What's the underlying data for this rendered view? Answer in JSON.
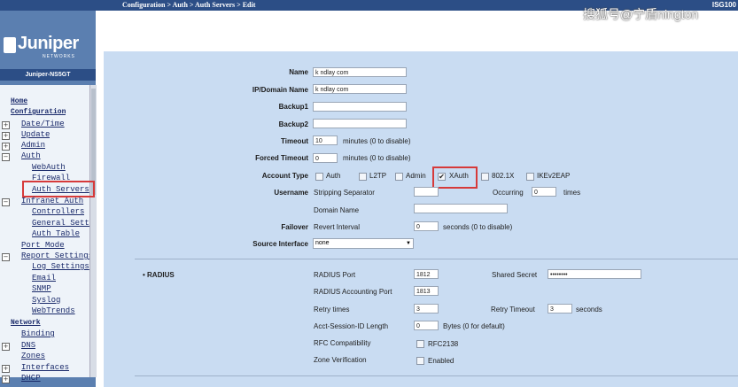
{
  "topbar": {
    "breadcrumb": "Configuration > Auth > Auth Servers > Edit",
    "device_model": "ISG100",
    "watermark": "搜狐号@宁盾nington"
  },
  "sidebar": {
    "logo": "Juniper",
    "logo_sub": "NETWORKS",
    "device_name": "Juniper-NS5GT",
    "items": [
      {
        "label": "Home",
        "level": 0
      },
      {
        "label": "Configuration",
        "level": 0
      },
      {
        "label": "Date/Time",
        "level": 1
      },
      {
        "label": "Update",
        "level": 1
      },
      {
        "label": "Admin",
        "level": 1
      },
      {
        "label": "Auth",
        "level": 1
      },
      {
        "label": "WebAuth",
        "level": 2
      },
      {
        "label": "Firewall",
        "level": 2
      },
      {
        "label": "Auth Servers",
        "level": 2
      },
      {
        "label": "Infranet Auth",
        "level": 1
      },
      {
        "label": "Controllers",
        "level": 2
      },
      {
        "label": "General Settings",
        "level": 2
      },
      {
        "label": "Auth Table",
        "level": 2
      },
      {
        "label": "Port Mode",
        "level": 1
      },
      {
        "label": "Report Settings",
        "level": 1
      },
      {
        "label": "Log Settings",
        "level": 2
      },
      {
        "label": "Email",
        "level": 2
      },
      {
        "label": "SNMP",
        "level": 2
      },
      {
        "label": "Syslog",
        "level": 2
      },
      {
        "label": "WebTrends",
        "level": 2
      },
      {
        "label": "Network",
        "level": 0
      },
      {
        "label": "Binding",
        "level": 1
      },
      {
        "label": "DNS",
        "level": 1
      },
      {
        "label": "Zones",
        "level": 1
      },
      {
        "label": "Interfaces",
        "level": 1
      },
      {
        "label": "DHCP",
        "level": 1
      }
    ]
  },
  "form": {
    "name_label": "Name",
    "name_value": "k ndlay com",
    "ip_label": "IP/Domain Name",
    "ip_value": "k ndlay com",
    "backup1_label": "Backup1",
    "backup2_label": "Backup2",
    "timeout_label": "Timeout",
    "timeout_value": "10",
    "timeout_suffix": "minutes (0 to disable)",
    "forced_timeout_label": "Forced Timeout",
    "forced_timeout_value": "0",
    "forced_timeout_suffix": "minutes (0 to disable)",
    "account_type_label": "Account Type",
    "account_types": [
      "Auth",
      "L2TP",
      "Admin",
      "XAuth",
      "802.1X",
      "IKEv2EAP"
    ],
    "account_type_checked": "XAuth",
    "username_label": "Username",
    "stripping_separator": "Stripping Separator",
    "occurring_label": "Occurring",
    "occurring_value": "0",
    "occurring_suffix": "times",
    "domain_name_label": "Domain Name",
    "failover_label": "Failover",
    "revert_interval_label": "Revert Interval",
    "revert_interval_value": "0",
    "revert_interval_suffix": "seconds (0 to disable)",
    "source_interface_label": "Source Interface",
    "source_interface_value": "none"
  },
  "radius": {
    "section_label": "RADIUS",
    "port_label": "RADIUS Port",
    "port_value": "1812",
    "accounting_port_label": "RADIUS Accounting Port",
    "accounting_port_value": "1813",
    "retry_times_label": "Retry times",
    "retry_times_value": "3",
    "acct_session_label": "Acct-Session-ID Length",
    "acct_session_value": "0",
    "acct_session_suffix": "Bytes (0 for default)",
    "rfc_label": "RFC Compatibility",
    "rfc_value": "RFC2138",
    "zone_label": "Zone Verification",
    "zone_value": "Enabled",
    "shared_secret_label": "Shared Secret",
    "shared_secret_value": "••••••••",
    "retry_timeout_label": "Retry Timeout",
    "retry_timeout_value": "3",
    "retry_timeout_suffix": "seconds"
  }
}
